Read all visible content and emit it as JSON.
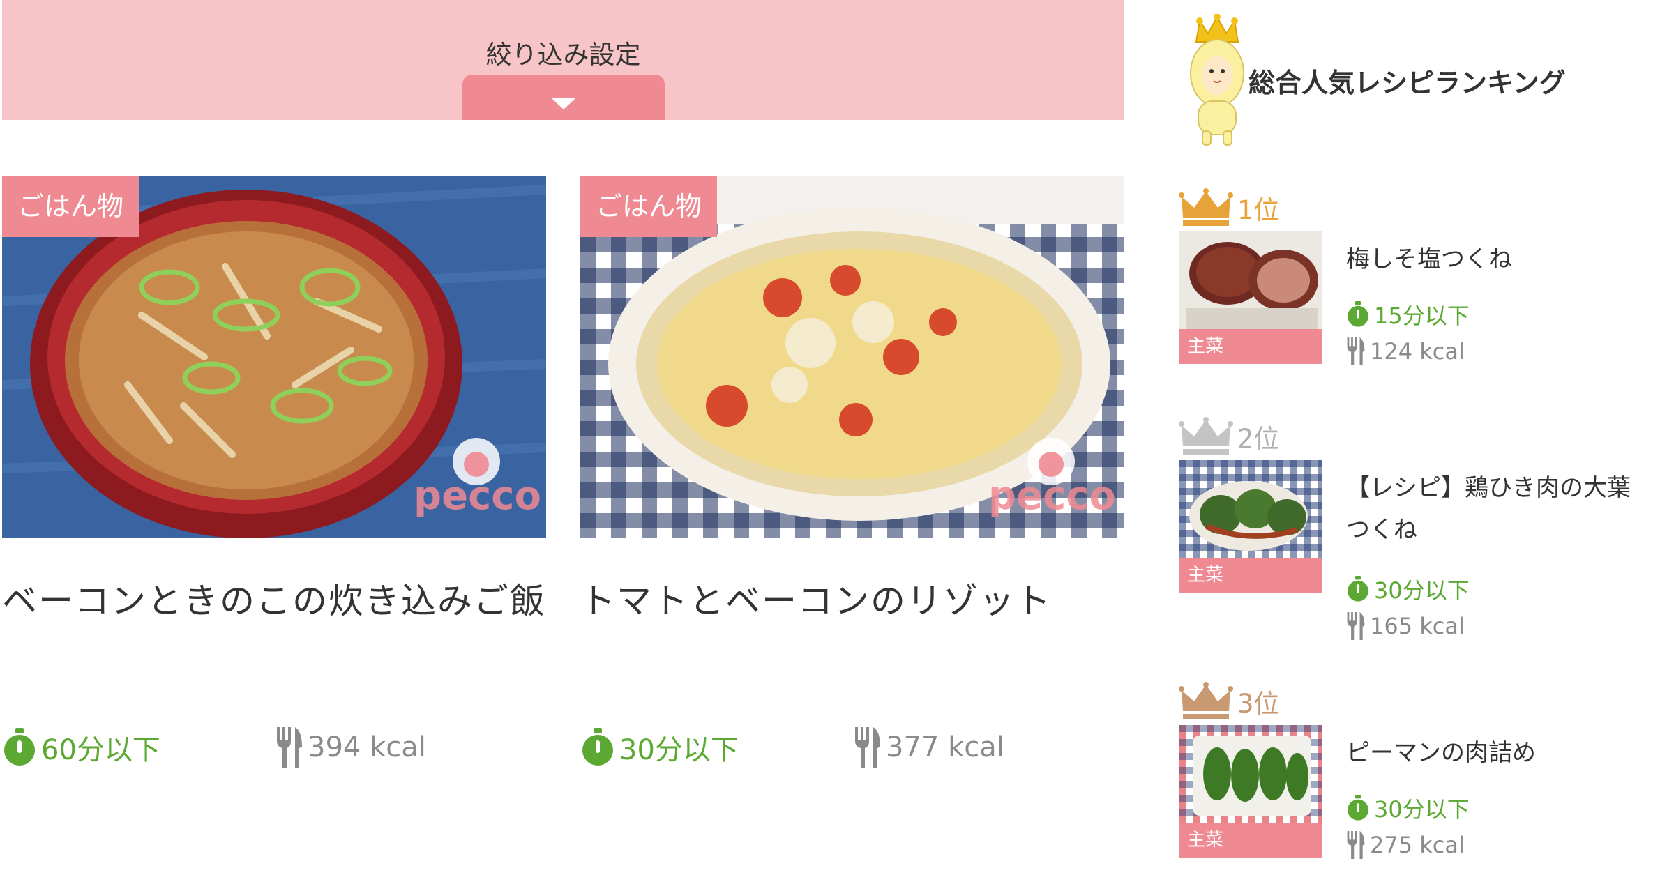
{
  "filter": {
    "label": "絞り込み設定"
  },
  "recipes": [
    {
      "category": "ごはん物",
      "title": "ベーコンときのこの炊き込みご飯",
      "time": "60分以下",
      "kcal": "394 kcal"
    },
    {
      "category": "ごはん物",
      "title": "トマトとベーコンのリゾット",
      "time": "30分以下",
      "kcal": "377 kcal"
    }
  ],
  "watermark": "pecco",
  "ranking": {
    "heading": "総合人気レシピランキング",
    "items": [
      {
        "rank": "1位",
        "category": "主菜",
        "title": "梅しそ塩つくね",
        "time": "15分以下",
        "kcal": "124 kcal",
        "crown_color": "#e8a23a"
      },
      {
        "rank": "2位",
        "category": "主菜",
        "title": "【レシピ】鶏ひき肉の大葉つくね",
        "time": "30分以下",
        "kcal": "165 kcal",
        "crown_color": "#c4c4c4"
      },
      {
        "rank": "3位",
        "category": "主菜",
        "title": "ピーマンの肉詰め",
        "time": "30分以下",
        "kcal": "275 kcal",
        "crown_color": "#c99a72"
      }
    ]
  },
  "colors": {
    "accent_pink": "#ef8a92",
    "filter_bg": "#f7c4c8",
    "time_green": "#5ba832",
    "kcal_gray": "#8a8a8a"
  }
}
